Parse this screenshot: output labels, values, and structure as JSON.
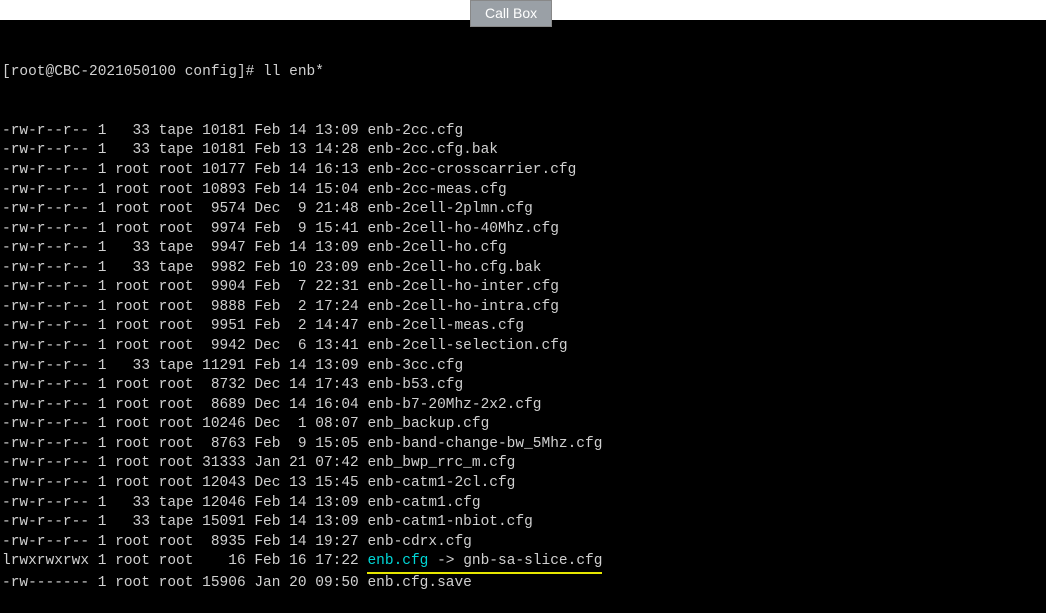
{
  "button": {
    "call_box": "Call Box"
  },
  "prompt": "[root@CBC-2021050100 config]# ll enb*",
  "files": [
    {
      "perm": "-rw-r--r--",
      "links": "1",
      "owner": "  33",
      "group": "tape",
      "size": "10181",
      "mon": "Feb",
      "day": "14",
      "time": "13:09",
      "name": "enb-2cc.cfg"
    },
    {
      "perm": "-rw-r--r--",
      "links": "1",
      "owner": "  33",
      "group": "tape",
      "size": "10181",
      "mon": "Feb",
      "day": "13",
      "time": "14:28",
      "name": "enb-2cc.cfg.bak"
    },
    {
      "perm": "-rw-r--r--",
      "links": "1",
      "owner": "root",
      "group": "root",
      "size": "10177",
      "mon": "Feb",
      "day": "14",
      "time": "16:13",
      "name": "enb-2cc-crosscarrier.cfg"
    },
    {
      "perm": "-rw-r--r--",
      "links": "1",
      "owner": "root",
      "group": "root",
      "size": "10893",
      "mon": "Feb",
      "day": "14",
      "time": "15:04",
      "name": "enb-2cc-meas.cfg"
    },
    {
      "perm": "-rw-r--r--",
      "links": "1",
      "owner": "root",
      "group": "root",
      "size": " 9574",
      "mon": "Dec",
      "day": " 9",
      "time": "21:48",
      "name": "enb-2cell-2plmn.cfg"
    },
    {
      "perm": "-rw-r--r--",
      "links": "1",
      "owner": "root",
      "group": "root",
      "size": " 9974",
      "mon": "Feb",
      "day": " 9",
      "time": "15:41",
      "name": "enb-2cell-ho-40Mhz.cfg"
    },
    {
      "perm": "-rw-r--r--",
      "links": "1",
      "owner": "  33",
      "group": "tape",
      "size": " 9947",
      "mon": "Feb",
      "day": "14",
      "time": "13:09",
      "name": "enb-2cell-ho.cfg"
    },
    {
      "perm": "-rw-r--r--",
      "links": "1",
      "owner": "  33",
      "group": "tape",
      "size": " 9982",
      "mon": "Feb",
      "day": "10",
      "time": "23:09",
      "name": "enb-2cell-ho.cfg.bak"
    },
    {
      "perm": "-rw-r--r--",
      "links": "1",
      "owner": "root",
      "group": "root",
      "size": " 9904",
      "mon": "Feb",
      "day": " 7",
      "time": "22:31",
      "name": "enb-2cell-ho-inter.cfg"
    },
    {
      "perm": "-rw-r--r--",
      "links": "1",
      "owner": "root",
      "group": "root",
      "size": " 9888",
      "mon": "Feb",
      "day": " 2",
      "time": "17:24",
      "name": "enb-2cell-ho-intra.cfg"
    },
    {
      "perm": "-rw-r--r--",
      "links": "1",
      "owner": "root",
      "group": "root",
      "size": " 9951",
      "mon": "Feb",
      "day": " 2",
      "time": "14:47",
      "name": "enb-2cell-meas.cfg"
    },
    {
      "perm": "-rw-r--r--",
      "links": "1",
      "owner": "root",
      "group": "root",
      "size": " 9942",
      "mon": "Dec",
      "day": " 6",
      "time": "13:41",
      "name": "enb-2cell-selection.cfg"
    },
    {
      "perm": "-rw-r--r--",
      "links": "1",
      "owner": "  33",
      "group": "tape",
      "size": "11291",
      "mon": "Feb",
      "day": "14",
      "time": "13:09",
      "name": "enb-3cc.cfg"
    },
    {
      "perm": "-rw-r--r--",
      "links": "1",
      "owner": "root",
      "group": "root",
      "size": " 8732",
      "mon": "Dec",
      "day": "14",
      "time": "17:43",
      "name": "enb-b53.cfg"
    },
    {
      "perm": "-rw-r--r--",
      "links": "1",
      "owner": "root",
      "group": "root",
      "size": " 8689",
      "mon": "Dec",
      "day": "14",
      "time": "16:04",
      "name": "enb-b7-20Mhz-2x2.cfg"
    },
    {
      "perm": "-rw-r--r--",
      "links": "1",
      "owner": "root",
      "group": "root",
      "size": "10246",
      "mon": "Dec",
      "day": " 1",
      "time": "08:07",
      "name": "enb_backup.cfg"
    },
    {
      "perm": "-rw-r--r--",
      "links": "1",
      "owner": "root",
      "group": "root",
      "size": " 8763",
      "mon": "Feb",
      "day": " 9",
      "time": "15:05",
      "name": "enb-band-change-bw_5Mhz.cfg"
    },
    {
      "perm": "-rw-r--r--",
      "links": "1",
      "owner": "root",
      "group": "root",
      "size": "31333",
      "mon": "Jan",
      "day": "21",
      "time": "07:42",
      "name": "enb_bwp_rrc_m.cfg"
    },
    {
      "perm": "-rw-r--r--",
      "links": "1",
      "owner": "root",
      "group": "root",
      "size": "12043",
      "mon": "Dec",
      "day": "13",
      "time": "15:45",
      "name": "enb-catm1-2cl.cfg"
    },
    {
      "perm": "-rw-r--r--",
      "links": "1",
      "owner": "  33",
      "group": "tape",
      "size": "12046",
      "mon": "Feb",
      "day": "14",
      "time": "13:09",
      "name": "enb-catm1.cfg"
    },
    {
      "perm": "-rw-r--r--",
      "links": "1",
      "owner": "  33",
      "group": "tape",
      "size": "15091",
      "mon": "Feb",
      "day": "14",
      "time": "13:09",
      "name": "enb-catm1-nbiot.cfg"
    },
    {
      "perm": "-rw-r--r--",
      "links": "1",
      "owner": "root",
      "group": "root",
      "size": " 8935",
      "mon": "Feb",
      "day": "14",
      "time": "19:27",
      "name": "enb-cdrx.cfg"
    },
    {
      "perm": "lrwxrwxrwx",
      "links": "1",
      "owner": "root",
      "group": "root",
      "size": "   16",
      "mon": "Feb",
      "day": "16",
      "time": "17:22",
      "name": "enb.cfg",
      "link_target": "gnb-sa-slice.cfg",
      "symlink": true,
      "highlight": true
    },
    {
      "perm": "-rw-------",
      "links": "1",
      "owner": "root",
      "group": "root",
      "size": "15906",
      "mon": "Jan",
      "day": "20",
      "time": "09:50",
      "name": "enb.cfg.save"
    }
  ]
}
